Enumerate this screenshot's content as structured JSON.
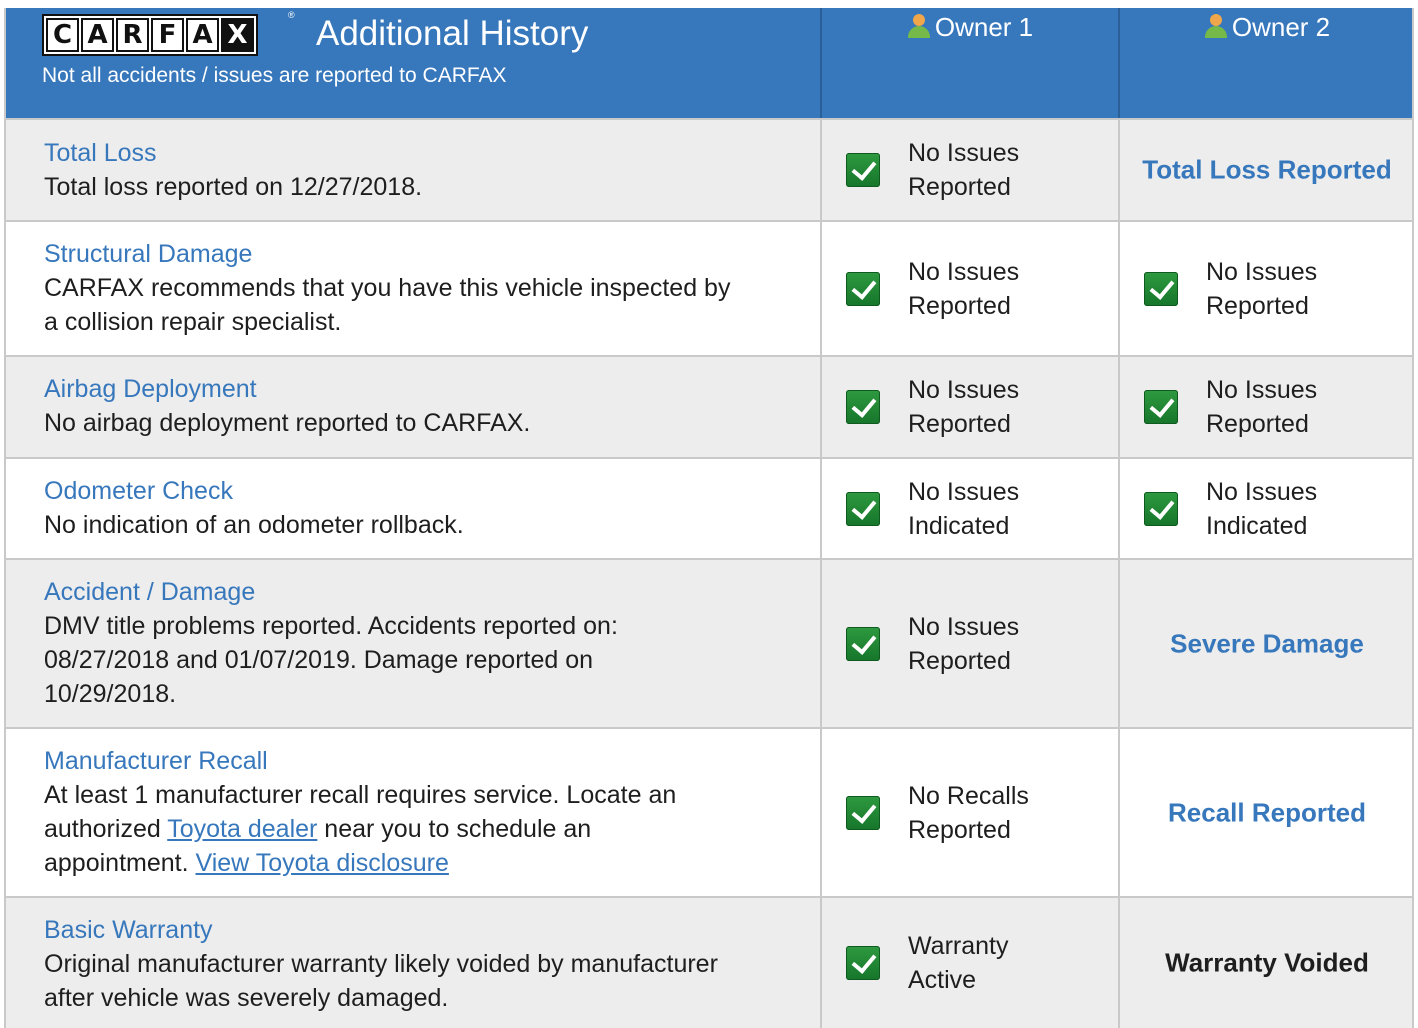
{
  "header": {
    "logo_letters": [
      "C",
      "A",
      "R",
      "F",
      "A",
      "X"
    ],
    "registered_mark": "®",
    "title": "Additional History",
    "subtitle": "Not all accidents / issues are reported to CARFAX",
    "owner1": "Owner 1",
    "owner2": "Owner 2",
    "icon_colors": {
      "head": "#f0a64a",
      "body": "#74b94a"
    }
  },
  "colors": {
    "header_bg": "#3777bc",
    "link": "#3777bc",
    "check_green": "#1f8a35",
    "row_alt": "#ededed"
  },
  "rows": [
    {
      "title": "Total Loss",
      "description": "Total loss reported on 12/27/2018.",
      "owner1": {
        "line1": "No Issues",
        "line2": "Reported",
        "icon": "check-icon"
      },
      "owner2": {
        "flag": "Total Loss Reported"
      }
    },
    {
      "title": "Structural Damage",
      "desc_line1": "CARFAX recommends that you have this vehicle inspected by",
      "desc_line2": "a collision repair specialist.",
      "owner1": {
        "line1": "No Issues",
        "line2": "Reported",
        "icon": "check-icon"
      },
      "owner2": {
        "line1": "No Issues",
        "line2": "Reported",
        "icon": "check-icon"
      }
    },
    {
      "title": "Airbag Deployment",
      "description": "No airbag deployment reported to CARFAX.",
      "owner1": {
        "line1": "No Issues",
        "line2": "Reported",
        "icon": "check-icon"
      },
      "owner2": {
        "line1": "No Issues",
        "line2": "Reported",
        "icon": "check-icon"
      }
    },
    {
      "title": "Odometer Check",
      "description": "No indication of an odometer rollback.",
      "owner1": {
        "line1": "No Issues",
        "line2": "Indicated",
        "icon": "check-icon"
      },
      "owner2": {
        "line1": "No Issues",
        "line2": "Indicated",
        "icon": "check-icon"
      }
    },
    {
      "title": "Accident / Damage",
      "desc_line1": "DMV title problems reported. Accidents reported on:",
      "desc_line2": "08/27/2018 and 01/07/2019. Damage reported on",
      "desc_line3": "10/29/2018.",
      "owner1": {
        "line1": "No Issues",
        "line2": "Reported",
        "icon": "check-icon"
      },
      "owner2": {
        "flag": "Severe Damage"
      }
    },
    {
      "title": "Manufacturer Recall",
      "desc_line1": "At least 1 manufacturer recall requires service. Locate an",
      "desc_line2_pre": "authorized ",
      "desc_line2_link": "Toyota dealer",
      "desc_line2_post": " near you to schedule an",
      "desc_line3_pre": "appointment. ",
      "desc_line3_link": "View Toyota disclosure",
      "owner1": {
        "line1": "No Recalls",
        "line2": "Reported",
        "icon": "check-icon"
      },
      "owner2": {
        "flag": "Recall Reported"
      }
    },
    {
      "title": "Basic Warranty",
      "desc_line1": "Original manufacturer warranty likely voided by manufacturer",
      "desc_line2": "after vehicle was severely damaged.",
      "owner1": {
        "line1": "Warranty",
        "line2": "Active",
        "icon": "check-icon"
      },
      "owner2": {
        "flag": "Warranty Voided"
      }
    }
  ]
}
